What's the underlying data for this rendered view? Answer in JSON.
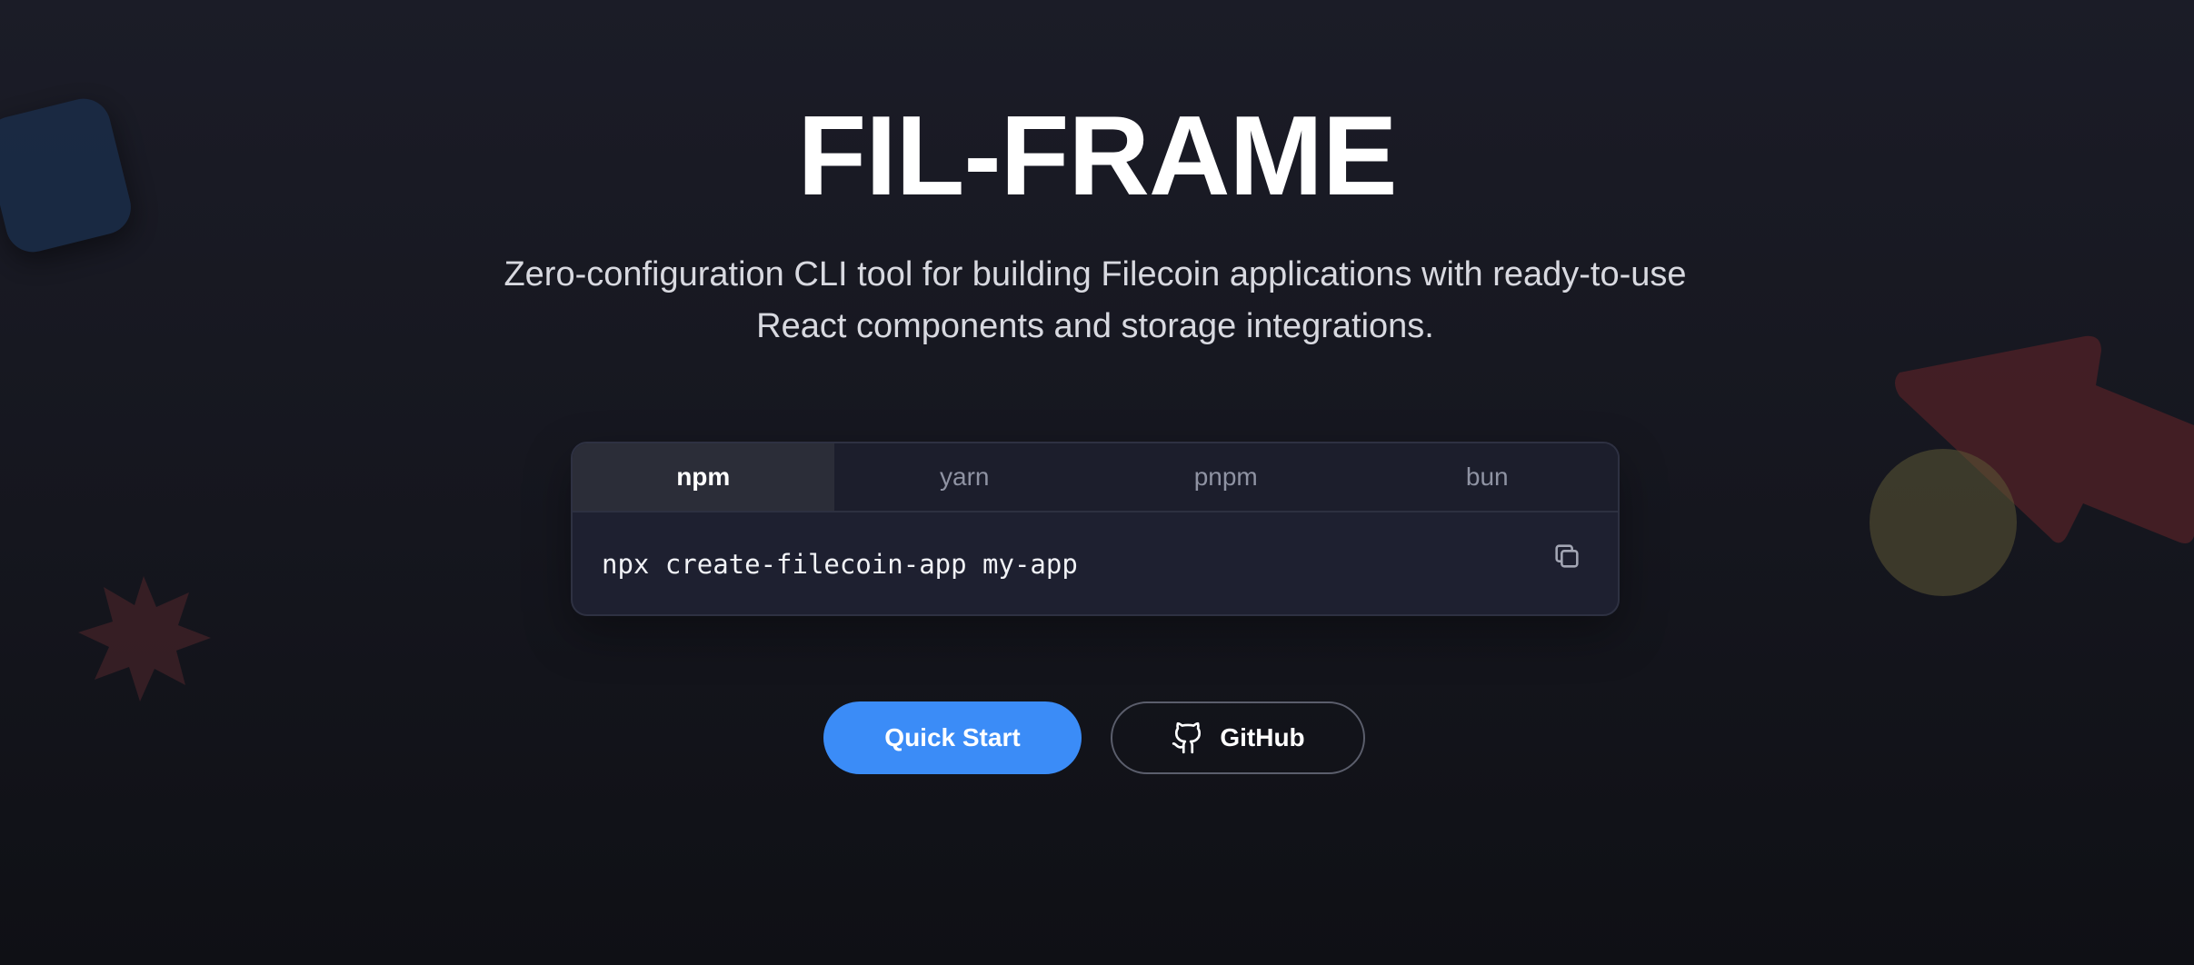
{
  "hero": {
    "title": "FIL-FRAME",
    "subtitle": "Zero-configuration CLI tool for building Filecoin applications with ready-to-use React components and storage integrations."
  },
  "install": {
    "tabs": [
      {
        "label": "npm",
        "active": true
      },
      {
        "label": "yarn",
        "active": false
      },
      {
        "label": "pnpm",
        "active": false
      },
      {
        "label": "bun",
        "active": false
      }
    ],
    "command": "npx create-filecoin-app my-app",
    "copy_icon": "copy-icon"
  },
  "actions": {
    "quick_start_label": "Quick Start",
    "github_label": "GitHub",
    "github_icon": "github-icon"
  },
  "colors": {
    "primary": "#3b8cf7",
    "background": "#16171f",
    "panel": "#1e2030"
  }
}
